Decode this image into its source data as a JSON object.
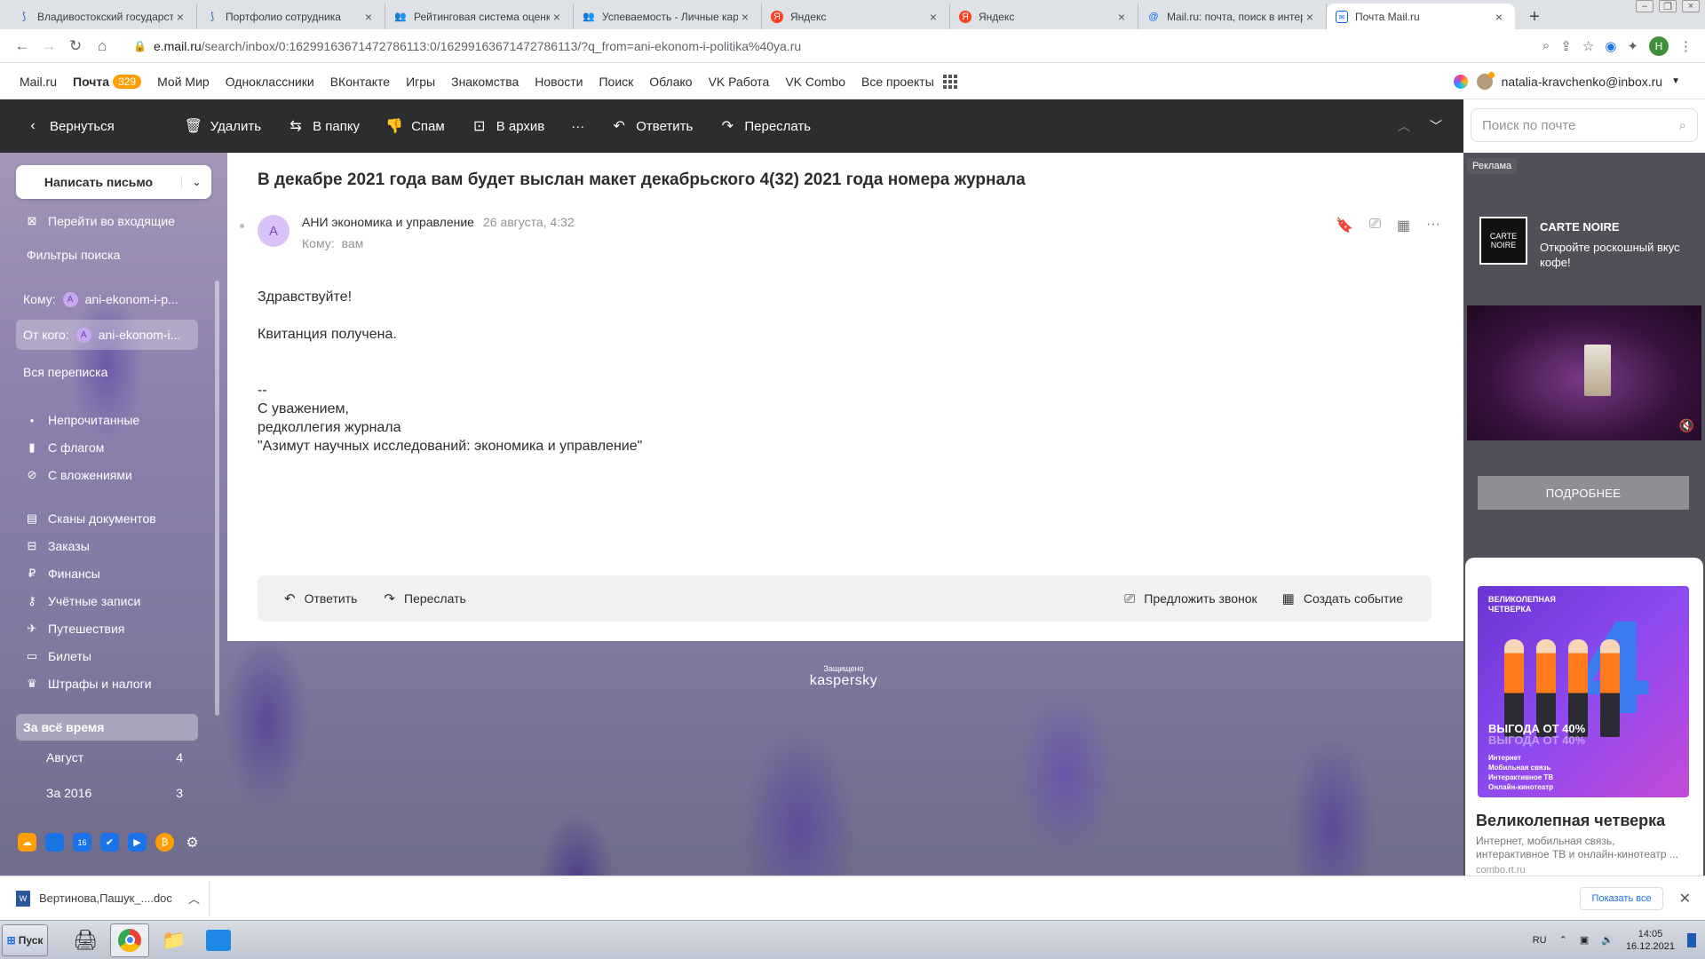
{
  "browser": {
    "tabs": [
      {
        "title": "Владивостокский государстве",
        "icon": "vvsu-icon",
        "active": false
      },
      {
        "title": "Портфолио сотрудника",
        "icon": "vvsu-icon",
        "active": false
      },
      {
        "title": "Рейтинговая система оценки",
        "icon": "people-icon",
        "active": false
      },
      {
        "title": "Успеваемость - Личные карто",
        "icon": "people-icon",
        "active": false
      },
      {
        "title": "Яндекс",
        "icon": "yandex-icon",
        "active": false
      },
      {
        "title": "Яндекс",
        "icon": "yandex-icon",
        "active": false
      },
      {
        "title": "Mail.ru: почта, поиск в интер",
        "icon": "mailru-icon",
        "active": false
      },
      {
        "title": "Почта Mail.ru",
        "icon": "mail-icon",
        "active": true
      }
    ],
    "url_host": "e.mail.ru",
    "url_path": "/search/inbox/0:16299163671472786113:0/16299163671472786113/?q_from=ani-ekonom-i-politika%40ya.ru",
    "profile_letter": "Н"
  },
  "portal": {
    "links": [
      "Mail.ru",
      "Почта",
      "Мой Мир",
      "Одноклассники",
      "ВКонтакте",
      "Игры",
      "Знакомства",
      "Новости",
      "Поиск",
      "Облако",
      "VK Работа",
      "VK Combo",
      "Все проекты"
    ],
    "mail_count": "329",
    "user_email": "natalia-kravchenko@inbox.ru"
  },
  "toolbar": {
    "back": "Вернуться",
    "delete": "Удалить",
    "to_folder": "В папку",
    "spam": "Спам",
    "archive": "В архив",
    "more": "···",
    "reply": "Ответить",
    "forward": "Переслать"
  },
  "search": {
    "placeholder": "Поиск по почте"
  },
  "sidebar": {
    "compose": "Написать письмо",
    "goto_inbox": "Перейти во входящие",
    "search_filters": "Фильтры поиска",
    "to_label": "Кому:",
    "to_value": "ani-ekonom-i-p...",
    "from_label": "От кого:",
    "from_value": "ani-ekonom-i...",
    "avatar_letter": "A",
    "all_correspondence": "Вся переписка",
    "filters": [
      {
        "label": "Непрочитанные",
        "icon": "dot-icon"
      },
      {
        "label": "С флагом",
        "icon": "bookmark-icon"
      },
      {
        "label": "С вложениями",
        "icon": "paperclip-icon"
      }
    ],
    "categories": [
      {
        "label": "Сканы документов",
        "icon": "scan-icon"
      },
      {
        "label": "Заказы",
        "icon": "cart-icon"
      },
      {
        "label": "Финансы",
        "icon": "ruble-icon"
      },
      {
        "label": "Учётные записи",
        "icon": "key-icon"
      },
      {
        "label": "Путешествия",
        "icon": "plane-icon"
      },
      {
        "label": "Билеты",
        "icon": "ticket-icon"
      },
      {
        "label": "Штрафы и налоги",
        "icon": "crown-icon"
      }
    ],
    "period_header": "За всё время",
    "periods": [
      {
        "label": "Август",
        "count": "4"
      },
      {
        "label": "За 2016",
        "count": "3"
      }
    ],
    "calendar_day": "16"
  },
  "message": {
    "subject": "В декабре 2021 года вам будет выслан макет декабрьского 4(32) 2021 года номера журнала",
    "sender": "АНИ экономика и управление",
    "sender_letter": "A",
    "date": "26 августа, 4:32",
    "to_label": "Кому:",
    "to_value": "вам",
    "body_lines": [
      "Здравствуйте!",
      "",
      "Квитанция получена.",
      "",
      "",
      "--",
      "С уважением,",
      "редколлегия журнала",
      "\"Азимут научных исследований: экономика и управление\""
    ],
    "reply": "Ответить",
    "forward": "Переслать",
    "suggest_call": "Предложить звонок",
    "create_event": "Создать событие"
  },
  "kaspersky": {
    "small": "Защищено",
    "brand": "kaspersky"
  },
  "ads": {
    "tag": "Реклама",
    "ad1_logo": "CARTE NOIRE",
    "ad1_title": "CARTE NOIRE",
    "ad1_desc": "Откройте роскошный вкус кофе!",
    "ad1_button": "ПОДРОБНЕЕ",
    "ad2_img_head": "ВЕЛИКОЛЕПНАЯ ЧЕТВЕРКА",
    "ad2_img_promo": "ВЫГОДА ОТ 40%",
    "ad2_img_features": [
      "Интернет",
      "Мобильная связь",
      "Интерактивное ТВ",
      "Онлайн-кинотеатр"
    ],
    "ad2_title": "Великолепная четверка",
    "ad2_desc": "Интернет, мобильная связь, интерактивное ТВ и онлайн-кинотеатр ...",
    "ad2_source": "combo.rt.ru"
  },
  "downloads": {
    "file": "Вертинова,Пашук_....doc",
    "show_all": "Показать все"
  },
  "taskbar": {
    "start": "Пуск",
    "lang": "RU",
    "time": "14:05",
    "date": "16.12.2021"
  }
}
